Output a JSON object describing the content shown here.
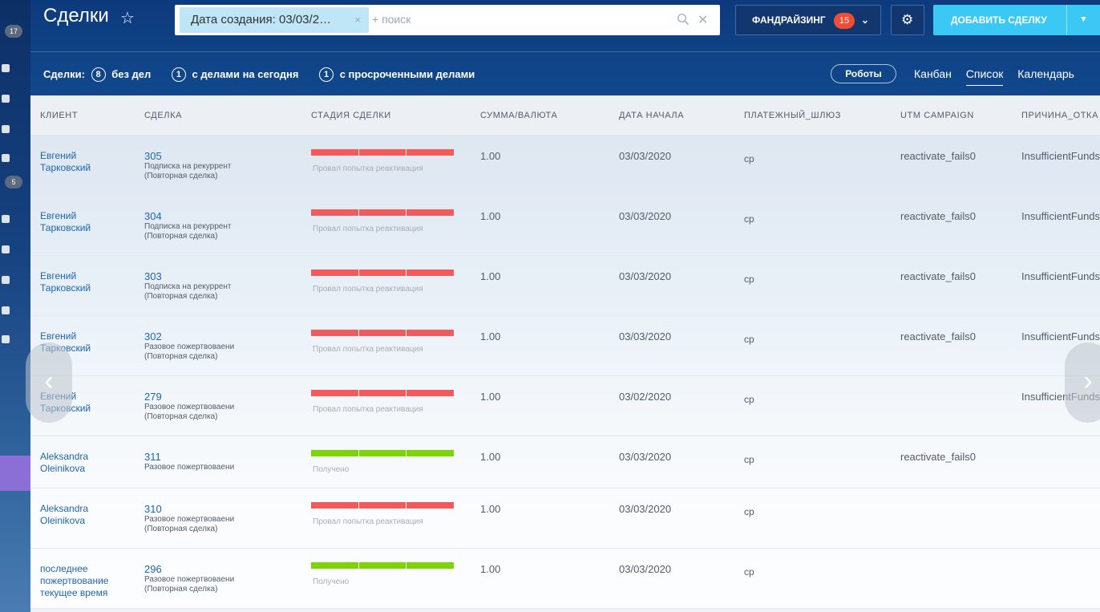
{
  "page": {
    "title": "Сделки"
  },
  "left_strip": {
    "badge_top": "17",
    "badge_mid": "5"
  },
  "search": {
    "filter_chip": "Дата создания: 03/03/2…",
    "placeholder": "+ поиск"
  },
  "toolbar": {
    "fundraising_label": "ФАНДРАЙЗИНГ",
    "fundraising_count": "15",
    "add_deal_label": "ДОБАВИТЬ СДЕЛКУ"
  },
  "counters": {
    "prefix": "Сделки:",
    "no_tasks_count": "8",
    "no_tasks_label": "без дел",
    "today_count": "1",
    "today_label": "с делами на сегодня",
    "overdue_count": "1",
    "overdue_label": "с просроченными делами"
  },
  "robots_label": "Роботы",
  "views": {
    "kanban": "Канбан",
    "list": "Список",
    "calendar": "Календарь"
  },
  "table": {
    "headers": [
      "КЛИЕНТ",
      "СДЕЛКА",
      "СТАДИЯ СДЕЛКИ",
      "СУММА/ВАЛЮТА",
      "ДАТА НАЧАЛА",
      "ПЛАТЕЖНЫЙ_ШЛЮЗ",
      "UTM CAMPAIGN",
      "ПРИЧИНА_ОТКА"
    ],
    "rows": [
      {
        "client": "Евгений Тарковский",
        "id": "305",
        "desc": "Подписка на рекуррент (Повторная сделка)",
        "stage": "Провал попытка реактивация",
        "stage_color": "#f25b5b",
        "amount": "1.00",
        "date": "03/03/2020",
        "gateway": "cp",
        "utm": "reactivate_fails0",
        "reason": "InsufficientFunds"
      },
      {
        "client": "Евгений Тарковский",
        "id": "304",
        "desc": "Подписка на рекуррент (Повторная сделка)",
        "stage": "Провал попытка реактивация",
        "stage_color": "#f25b5b",
        "amount": "1.00",
        "date": "03/03/2020",
        "gateway": "cp",
        "utm": "reactivate_fails0",
        "reason": "InsufficientFunds"
      },
      {
        "client": "Евгений Тарковский",
        "id": "303",
        "desc": "Подписка на рекуррент (Повторная сделка)",
        "stage": "Провал попытка реактивация",
        "stage_color": "#f25b5b",
        "amount": "1.00",
        "date": "03/03/2020",
        "gateway": "cp",
        "utm": "reactivate_fails0",
        "reason": "InsufficientFunds"
      },
      {
        "client": "Евгений Тарковский",
        "id": "302",
        "desc": "Разовое пожертвоваени (Повторная сделка)",
        "stage": "Провал попытка реактивация",
        "stage_color": "#f25b5b",
        "amount": "1.00",
        "date": "03/03/2020",
        "gateway": "cp",
        "utm": "reactivate_fails0",
        "reason": "InsufficientFunds"
      },
      {
        "client": "Евгений Тарковский",
        "id": "279",
        "desc": "Разовое пожертвоваени (Повторная сделка)",
        "stage": "Провал попытка реактивация",
        "stage_color": "#f25b5b",
        "amount": "1.00",
        "date": "03/02/2020",
        "gateway": "cp",
        "utm": "",
        "reason": "InsufficientFunds"
      },
      {
        "client": "Aleksandra Oleinikova",
        "id": "311",
        "desc": "Разовое пожертвоваени",
        "stage": "Получено",
        "stage_color": "#7bd500",
        "amount": "1.00",
        "date": "03/03/2020",
        "gateway": "cp",
        "utm": "reactivate_fails0",
        "reason": ""
      },
      {
        "client": "Aleksandra Oleinikova",
        "id": "310",
        "desc": "Разовое пожертвоваени (Повторная сделка)",
        "stage": "Провал попытка реактивация",
        "stage_color": "#f25b5b",
        "amount": "1.00",
        "date": "03/03/2020",
        "gateway": "cp",
        "utm": "",
        "reason": ""
      },
      {
        "client": "последнее пожертвование текущее время",
        "id": "296",
        "desc": "Разовое пожертвоваени (Повторная сделка)",
        "stage": "Получено",
        "stage_color": "#7bd500",
        "amount": "1.00",
        "date": "03/03/2020",
        "gateway": "cp",
        "utm": "",
        "reason": ""
      }
    ]
  },
  "colors": {
    "link": "#2066b0",
    "fail_stage": "#f25b5b",
    "success_stage": "#7bd500",
    "add_button": "#3bc8f5",
    "badge": "#f04d36"
  },
  "icons": {
    "favorite": "star-icon",
    "search": "search-icon",
    "clear": "close-icon",
    "settings": "gear-icon",
    "dropdown": "chevron-down-icon",
    "prev": "chevron-left-icon",
    "next": "chevron-right-icon"
  }
}
